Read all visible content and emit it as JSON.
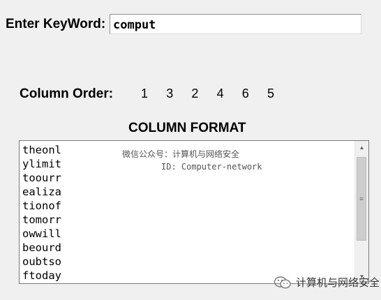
{
  "keyword": {
    "label": "Enter KeyWord:",
    "value": "comput"
  },
  "column_order": {
    "label": "Column Order:",
    "values": [
      "1",
      "3",
      "2",
      "4",
      "6",
      "5"
    ]
  },
  "column_format": {
    "title": "COLUMN FORMAT",
    "lines": [
      "theonl",
      "ylimit",
      "toourr",
      "ealiza",
      "tionof",
      "tomorr",
      "owwill",
      "beourd",
      "oubtso",
      "ftoday"
    ]
  },
  "watermark": {
    "line1": "微信公众号：计算机与网络安全",
    "line2": "ID: Computer-network"
  },
  "brand": {
    "text": "计算机与网络安全",
    "icon": "wechat-icon"
  },
  "scrollbar": {
    "up_icon": "arrow-up-icon",
    "down_icon": "arrow-down-icon",
    "grip_icon": "grip-icon"
  }
}
